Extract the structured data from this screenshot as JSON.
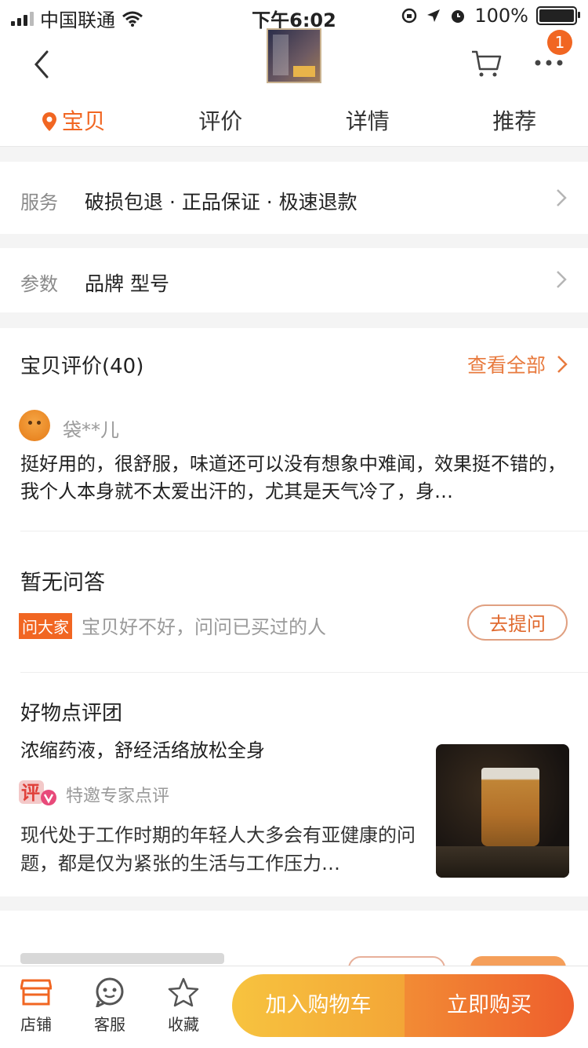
{
  "status_bar": {
    "carrier": "中国联通",
    "time": "下午6:02",
    "battery": "100%",
    "battery_level": 1.0
  },
  "nav": {
    "cart_badge": "1",
    "tabs": [
      {
        "label": "宝贝"
      },
      {
        "label": "评价"
      },
      {
        "label": "详情"
      },
      {
        "label": "推荐"
      }
    ]
  },
  "service": {
    "label": "服务",
    "value": "破损包退 · 正品保证 · 极速退款"
  },
  "params": {
    "label": "参数",
    "value": "品牌 型号"
  },
  "reviews": {
    "title": "宝贝评价(40)",
    "view_all": "查看全部",
    "username": "袋**儿",
    "text": "挺好用的，很舒服，味道还可以没有想象中难闻，效果挺不错的，我个人本身就不太爱出汗的，尤其是天气冷了，身…"
  },
  "qa": {
    "title": "暂无问答",
    "tag": "问大家",
    "hint": "宝贝好不好，问问已买过的人",
    "ask_button": "去提问"
  },
  "good_picks": {
    "title": "好物点评团",
    "subtitle": "浓缩药液，舒经活络放松全身",
    "icon_text": "评",
    "expert": "特邀专家点评",
    "text": "现代处于工作时期的年轻人大多会有亚健康的问题，都是仅为紧张的生活与工作压力…"
  },
  "bottom_bar": {
    "shop": "店铺",
    "service": "客服",
    "favorite": "收藏",
    "add_to_cart": "加入购物车",
    "buy_now": "立即购买"
  },
  "colors": {
    "accent": "#f16622",
    "cart_btn": "#f7c33f",
    "buy_btn": "#ee5e2c"
  }
}
